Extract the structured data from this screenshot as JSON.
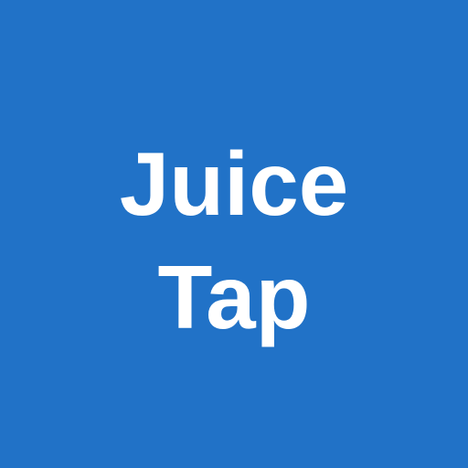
{
  "app": {
    "title_line_1": "Juice",
    "title_line_2": "Tap",
    "background_color": "#2172c7",
    "text_color": "#ffffff"
  }
}
